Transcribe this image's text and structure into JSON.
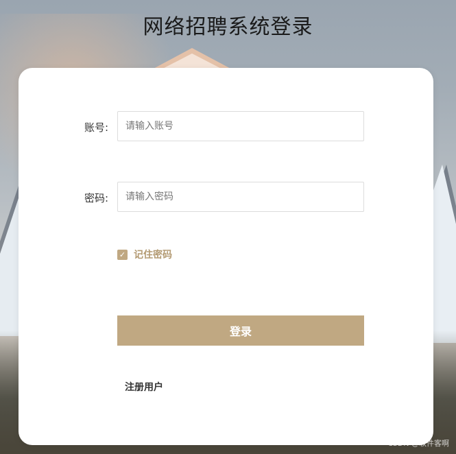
{
  "page": {
    "title": "网络招聘系统登录"
  },
  "form": {
    "account": {
      "label": "账号:",
      "placeholder": "请输入账号",
      "value": ""
    },
    "password": {
      "label": "密码:",
      "placeholder": "请输入密码",
      "value": ""
    },
    "remember": {
      "label": "记住密码",
      "checked": true,
      "check_glyph": "✓"
    },
    "login_button": "登录",
    "register_link": "注册用户"
  },
  "watermark": "CSDN @软件客啊",
  "colors": {
    "accent": "#c0a882",
    "card": "#ffffff"
  }
}
